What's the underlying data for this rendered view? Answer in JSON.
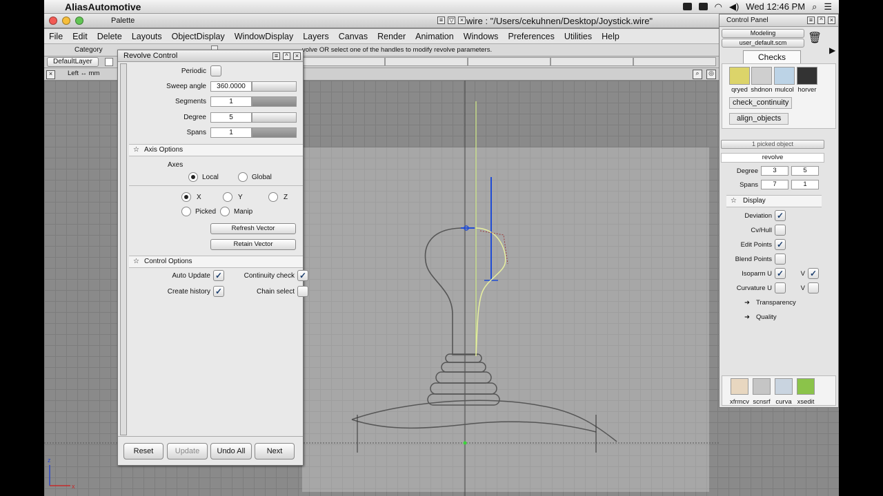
{
  "os": {
    "app_name": "AliasAutomotive",
    "clock": "Wed 12:46 PM"
  },
  "palette": {
    "title": "Palette",
    "category_label": "Category",
    "layer_button": "DefaultLayer",
    "view_label": "Left ↔ mm"
  },
  "window": {
    "title": "wire : \"/Users/cekuhnen/Desktop/Joystick.wire\""
  },
  "menu": [
    "File",
    "Edit",
    "Delete",
    "Layouts",
    "ObjectDisplay",
    "WindowDisplay",
    "Layers",
    "Canvas",
    "Render",
    "Animation",
    "Windows",
    "Preferences",
    "Utilities",
    "Help"
  ],
  "prompt": "volve OR select one of the handles to modify revolve parameters.",
  "revolve": {
    "title": "Revolve Control",
    "periodic_label": "Periodic",
    "sweep_label": "Sweep angle",
    "sweep_value": "360.0000",
    "segments_label": "Segments",
    "segments_value": "1",
    "degree_label": "Degree",
    "degree_value": "5",
    "spans_label": "Spans",
    "spans_value": "1",
    "axis_section": "Axis Options",
    "axes_label": "Axes",
    "local": "Local",
    "global": "Global",
    "x": "X",
    "y": "Y",
    "z": "Z",
    "picked": "Picked",
    "manip": "Manip",
    "refresh": "Refresh Vector",
    "retain": "Retain Vector",
    "control_section": "Control Options",
    "auto_update": "Auto Update",
    "continuity_check": "Continuity check",
    "create_history": "Create history",
    "chain_select": "Chain select",
    "reset": "Reset",
    "update": "Update",
    "undo_all": "Undo All",
    "next": "Next"
  },
  "control_panel": {
    "title": "Control Panel",
    "mode": "Modeling",
    "shelf_file": "user_default.scm",
    "tab": "Checks",
    "tools": [
      "qryed",
      "shdnon",
      "mulcol",
      "horver"
    ],
    "check_continuity": "check_continuity",
    "align_objects": "align_objects",
    "picked": "1 picked object",
    "object_name": "revolve",
    "degree_label": "Degree",
    "degree_u": "3",
    "degree_v": "5",
    "spans_label": "Spans",
    "spans_u": "7",
    "spans_v": "1",
    "display_section": "Display",
    "deviation": "Deviation",
    "cvhull": "Cv/Hull",
    "edit_points": "Edit Points",
    "blend_points": "Blend Points",
    "isoparm": "Isoparm U",
    "curvature": "Curvature U",
    "v": "V",
    "transparency": "Transparency",
    "quality": "Quality",
    "bottom_tools": [
      "xfrmcv",
      "scnsrf",
      "curva",
      "xsedit"
    ]
  }
}
